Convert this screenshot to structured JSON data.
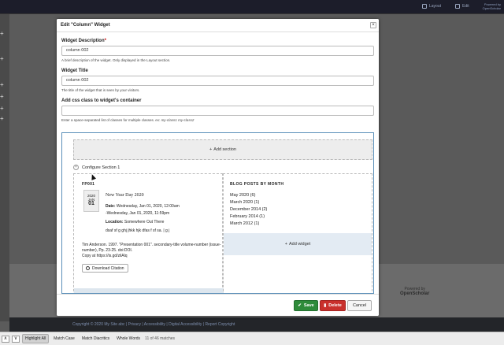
{
  "topbar": {
    "layout_label": "Layout",
    "edit_label": "Edit",
    "powered_line1": "Powered by",
    "powered_line2": "OpenScholar"
  },
  "modal": {
    "title": "Edit \"Column\" Widget",
    "close_label": "×",
    "fields": {
      "description": {
        "label": "Widget Description",
        "required_mark": "*",
        "value": "column 002",
        "help": "A brief description of the widget. Only displayed in the Layout section."
      },
      "title": {
        "label": "Widget Title",
        "value": "column 002",
        "help": "The title of the widget that is seen by your visitors."
      },
      "css": {
        "label": "Add css class to widget's container",
        "value": "",
        "help_prefix": "Enter a space-separated list of classes for multiple classes. ex: ",
        "help_example": "my-class1 my-class2"
      }
    },
    "preview": {
      "add_section": "Add section",
      "configure_section": "Configure Section 1",
      "left": {
        "fp_label": "FP001",
        "date_year": "2020",
        "date_month": "JAN",
        "date_day": "01",
        "event_title": "New Year Day 2020",
        "date_label": "Date:",
        "date_value": "Wednesday, Jan 01, 2020, 12:00am",
        "date_value2": "-Wednesday, Jan 01, 2020, 11:59pm",
        "location_label": "Location:",
        "location_value": "Somewhere Out There",
        "body_text": "dsaf sf g ghj jhkk hjk dfas f sf sa. | g j",
        "citation": "Tim Anderson. 1997. \"Presentation 001\". secondary-title volume-number (issue-number), Pp. 23-25. doi:DOI.",
        "copy_at": "Copy at https://is.gd/zilAlq",
        "download_label": "Download Citation"
      },
      "right": {
        "heading": "BLOG POSTS BY MONTH",
        "items": [
          "May 2020 (6)",
          "March 2020 (1)",
          "December 2014 (2)",
          "February 2014 (1)",
          "March 2012 (1)"
        ],
        "add_widget": "Add widget"
      }
    },
    "footer": {
      "save": "Save",
      "delete": "Delete",
      "cancel": "Cancel"
    }
  },
  "page_footer": {
    "copyright": "Copyright © 2020 My Site abc",
    "links": [
      "Privacy",
      "Accessibility",
      "Digital Accessibility",
      "Report Copyright"
    ],
    "powered_line1": "Powered by",
    "powered_line2": "OpenScholar"
  },
  "findbar": {
    "prev": "∧",
    "next": "∨",
    "highlight_all": "Highlight All",
    "match_case": "Match Case",
    "match_diacritics": "Match Diacritics",
    "whole_words": "Whole Words",
    "status": "11 of 46 matches"
  },
  "colors": {
    "save": "#2e8b3a",
    "delete": "#c9302c",
    "preview_border": "#5b8fb9"
  }
}
